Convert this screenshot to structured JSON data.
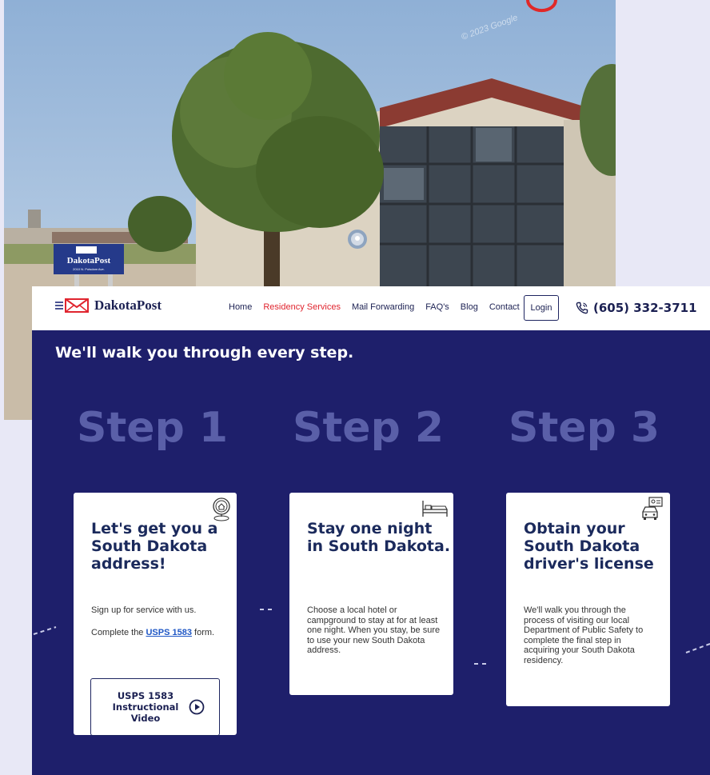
{
  "photo": {
    "watermark": "© 2023 Google",
    "sign_name": "DakotaPost",
    "sign_address": "2010 N. Potsdam Ave."
  },
  "header": {
    "logo_text": "DakotaPost",
    "nav": [
      {
        "label": "Home"
      },
      {
        "label": "Residency Services"
      },
      {
        "label": "Mail Forwarding"
      },
      {
        "label": "FAQ's"
      },
      {
        "label": "Blog"
      },
      {
        "label": "Contact"
      }
    ],
    "login_label": "Login",
    "phone": "(605) 332-3711"
  },
  "main": {
    "headline": "We'll walk you through every step.",
    "steps": [
      {
        "step_label": "Step 1",
        "title": "Let's get you a South Dakota address!",
        "body_1": "Sign up for service with us.",
        "body_2_prefix": "Complete the ",
        "body_2_link": "USPS 1583",
        "body_2_suffix": " form.",
        "button_label": "USPS 1583 Instructional Video",
        "icon": "home-location-icon"
      },
      {
        "step_label": "Step 2",
        "title": "Stay one night in South Dakota.",
        "body": "Choose a local hotel or campground to stay at for at least one night. When you stay, be sure to use your new South Dakota address.",
        "icon": "bed-icon"
      },
      {
        "step_label": "Step 3",
        "title": "Obtain your South Dakota driver's license",
        "body": "We'll walk you through the process of visiting our local Department of Public Safety to complete the final step in acquiring your South Dakota residency.",
        "icon": "car-license-icon"
      }
    ]
  },
  "colors": {
    "brand_navy": "#1e1f6b",
    "nav_active": "#e0252f",
    "step_label": "#5a5fa8",
    "link": "#1f57c5"
  }
}
